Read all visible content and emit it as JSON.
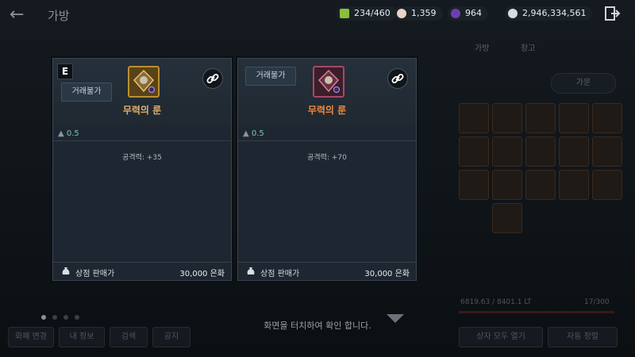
{
  "header": {
    "title": "가방",
    "resources": [
      {
        "name": "inventory-weight",
        "value": "234/460",
        "color": "#8bbf3c"
      },
      {
        "name": "pearl",
        "value": "1,359",
        "color": "#e8d4c8"
      },
      {
        "name": "dark-stone",
        "value": "964",
        "color": "#6b3fb3"
      },
      {
        "name": "silver",
        "value": "2,946,334,561",
        "color": "#d6dde3"
      }
    ]
  },
  "background": {
    "tabs": [
      "가방",
      "창고"
    ],
    "toggle": "가문",
    "weight": "6819.63 / 8401.1 LT",
    "slots": "17/300",
    "hint": "화면을 터치하여 확인 합니다.",
    "bottom_buttons": [
      "화폐 변경",
      "내 정보",
      "검색",
      "공지",
      "상자 모두 열기",
      "자동 정렬"
    ]
  },
  "cards": [
    {
      "grade": "E",
      "trade_label": "거래불가",
      "item_name": "무력의 룬",
      "weight": "0.5",
      "stat": "공격력: +35",
      "sell_label": "상점 판매가",
      "sell_price": "30,000 은화",
      "accent": "#e3b06a"
    },
    {
      "trade_label": "거래불가",
      "item_name": "무력의 룬",
      "weight": "0.5",
      "stat": "공격력: +70",
      "sell_label": "상점 판매가",
      "sell_price": "30,000 은화",
      "accent": "#f08a3a"
    }
  ]
}
